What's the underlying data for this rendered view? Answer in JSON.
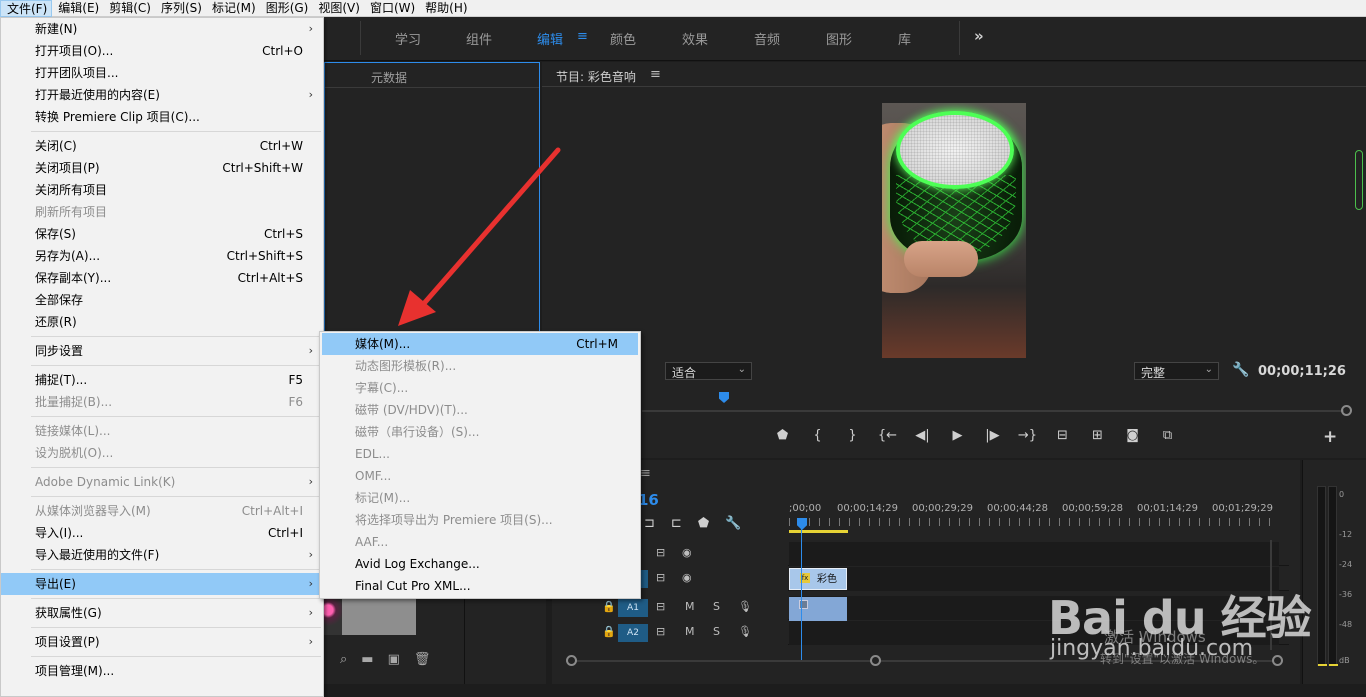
{
  "menubar": {
    "items": [
      "文件(F)",
      "编辑(E)",
      "剪辑(C)",
      "序列(S)",
      "标记(M)",
      "图形(G)",
      "视图(V)",
      "窗口(W)",
      "帮助(H)"
    ]
  },
  "workspaces": {
    "items": [
      "学习",
      "组件",
      "编辑",
      "颜色",
      "效果",
      "音频",
      "图形",
      "库"
    ],
    "active": "编辑",
    "menu_icon": "hamburger-icon",
    "more_icon": "chevron-double-right-icon"
  },
  "source_panel": {
    "tab": "元数据"
  },
  "program": {
    "title": "节目: 彩色音响",
    "fit": "适合",
    "quality": "完整",
    "timecode": "00;00;11;26"
  },
  "timeline": {
    "timecode_partial": "16",
    "ruler": [
      ";00;00",
      "00;00;14;29",
      "00;00;29;29",
      "00;00;44;28",
      "00;00;59;28",
      "00;01;14;29",
      "00;01;29;29"
    ],
    "tracks": [
      {
        "name": "",
        "kind": "video"
      },
      {
        "name": "",
        "kind": "video"
      },
      {
        "name": "A1",
        "kind": "audio",
        "m": "M",
        "s": "S"
      },
      {
        "name": "A2",
        "kind": "audio",
        "m": "M",
        "s": "S"
      }
    ],
    "clip_label": "彩色"
  },
  "meters": {
    "labels": [
      "0",
      "-12",
      "-24",
      "-36",
      "-48",
      "dB"
    ]
  },
  "file_menu": {
    "groups": [
      [
        {
          "label": "新建(N)",
          "shortcut": "",
          "submenu": true,
          "disabled": false
        },
        {
          "label": "打开项目(O)...",
          "shortcut": "Ctrl+O",
          "submenu": false,
          "disabled": false
        },
        {
          "label": "打开团队项目...",
          "shortcut": "",
          "submenu": false,
          "disabled": false
        },
        {
          "label": "打开最近使用的内容(E)",
          "shortcut": "",
          "submenu": true,
          "disabled": false
        },
        {
          "label": "转换 Premiere Clip 项目(C)...",
          "shortcut": "",
          "submenu": false,
          "disabled": false
        }
      ],
      [
        {
          "label": "关闭(C)",
          "shortcut": "Ctrl+W",
          "submenu": false,
          "disabled": false
        },
        {
          "label": "关闭项目(P)",
          "shortcut": "Ctrl+Shift+W",
          "submenu": false,
          "disabled": false
        },
        {
          "label": "关闭所有项目",
          "shortcut": "",
          "submenu": false,
          "disabled": false
        },
        {
          "label": "刷新所有项目",
          "shortcut": "",
          "submenu": false,
          "disabled": true
        },
        {
          "label": "保存(S)",
          "shortcut": "Ctrl+S",
          "submenu": false,
          "disabled": false
        },
        {
          "label": "另存为(A)...",
          "shortcut": "Ctrl+Shift+S",
          "submenu": false,
          "disabled": false
        },
        {
          "label": "保存副本(Y)...",
          "shortcut": "Ctrl+Alt+S",
          "submenu": false,
          "disabled": false
        },
        {
          "label": "全部保存",
          "shortcut": "",
          "submenu": false,
          "disabled": false
        },
        {
          "label": "还原(R)",
          "shortcut": "",
          "submenu": false,
          "disabled": false
        }
      ],
      [
        {
          "label": "同步设置",
          "shortcut": "",
          "submenu": true,
          "disabled": false
        }
      ],
      [
        {
          "label": "捕捉(T)...",
          "shortcut": "F5",
          "submenu": false,
          "disabled": false
        },
        {
          "label": "批量捕捉(B)...",
          "shortcut": "F6",
          "submenu": false,
          "disabled": true
        }
      ],
      [
        {
          "label": "链接媒体(L)...",
          "shortcut": "",
          "submenu": false,
          "disabled": true
        },
        {
          "label": "设为脱机(O)...",
          "shortcut": "",
          "submenu": false,
          "disabled": true
        }
      ],
      [
        {
          "label": "Adobe Dynamic Link(K)",
          "shortcut": "",
          "submenu": true,
          "disabled": true
        }
      ],
      [
        {
          "label": "从媒体浏览器导入(M)",
          "shortcut": "Ctrl+Alt+I",
          "submenu": false,
          "disabled": true
        },
        {
          "label": "导入(I)...",
          "shortcut": "Ctrl+I",
          "submenu": false,
          "disabled": false
        },
        {
          "label": "导入最近使用的文件(F)",
          "shortcut": "",
          "submenu": true,
          "disabled": false
        }
      ],
      [
        {
          "label": "导出(E)",
          "shortcut": "",
          "submenu": true,
          "disabled": false,
          "highlighted": true
        }
      ],
      [
        {
          "label": "获取属性(G)",
          "shortcut": "",
          "submenu": true,
          "disabled": false
        }
      ],
      [
        {
          "label": "项目设置(P)",
          "shortcut": "",
          "submenu": true,
          "disabled": false
        }
      ],
      [
        {
          "label": "项目管理(M)...",
          "shortcut": "",
          "submenu": false,
          "disabled": false
        }
      ]
    ]
  },
  "export_submenu": {
    "items": [
      {
        "label": "媒体(M)...",
        "shortcut": "Ctrl+M",
        "disabled": false,
        "highlighted": true
      },
      {
        "label": "动态图形模板(R)...",
        "shortcut": "",
        "disabled": true
      },
      {
        "label": "字幕(C)...",
        "shortcut": "",
        "disabled": true
      },
      {
        "label": "磁带 (DV/HDV)(T)...",
        "shortcut": "",
        "disabled": true
      },
      {
        "label": "磁带（串行设备）(S)...",
        "shortcut": "",
        "disabled": true
      },
      {
        "label": "EDL...",
        "shortcut": "",
        "disabled": true
      },
      {
        "label": "OMF...",
        "shortcut": "",
        "disabled": true
      },
      {
        "label": "标记(M)...",
        "shortcut": "",
        "disabled": true
      },
      {
        "label": "将选择项导出为 Premiere 项目(S)...",
        "shortcut": "",
        "disabled": true
      },
      {
        "label": "AAF...",
        "shortcut": "",
        "disabled": true
      },
      {
        "label": "Avid Log Exchange...",
        "shortcut": "",
        "disabled": false
      },
      {
        "label": "Final Cut Pro XML...",
        "shortcut": "",
        "disabled": false
      }
    ]
  },
  "watermark": {
    "logo": "Bai du 经验",
    "site": "jingyan.baidu.com"
  },
  "activation": {
    "line1": "激活 Windows",
    "line2": "转到\"设置\"以激活 Windows。"
  },
  "colors": {
    "accent": "#2d8ceb",
    "menu_highlight": "#91c9f7",
    "arrow": "#e8312f"
  }
}
